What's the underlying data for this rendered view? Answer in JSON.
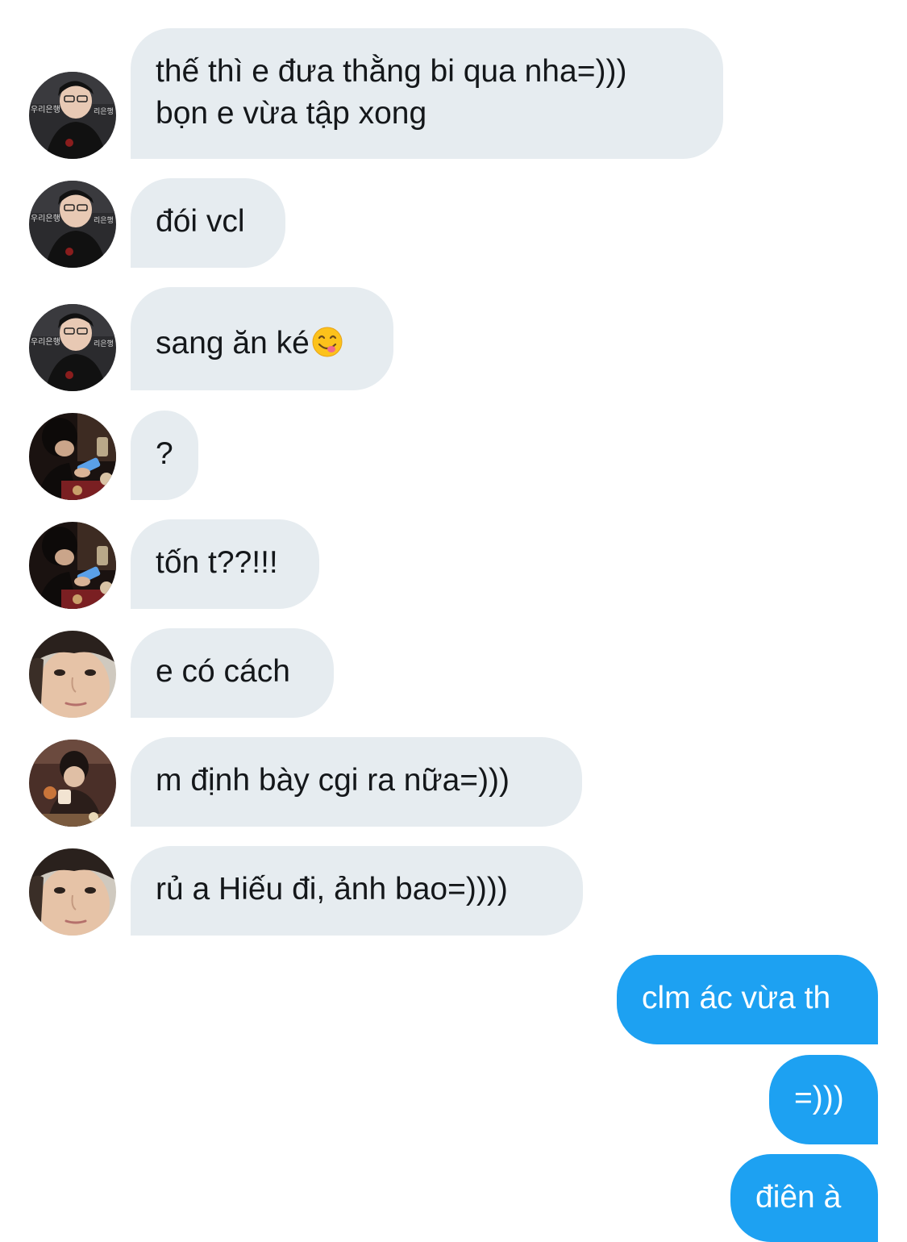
{
  "conversation": {
    "messages": [
      {
        "sender": "incoming",
        "avatar_icon": "person-avatar-1",
        "lines": [
          "thế thì e đưa thằng bi qua nha=)))",
          "bọn e vừa tập xong"
        ]
      },
      {
        "sender": "incoming",
        "avatar_icon": "person-avatar-1",
        "lines": [
          "đói vcl"
        ]
      },
      {
        "sender": "incoming",
        "avatar_icon": "person-avatar-1",
        "lines": [
          "sang ăn ké"
        ],
        "emoji": "face-savoring-food-icon"
      },
      {
        "sender": "incoming",
        "avatar_icon": "person-avatar-2",
        "lines": [
          "?"
        ]
      },
      {
        "sender": "incoming",
        "avatar_icon": "person-avatar-2",
        "lines": [
          "tốn t??!!!"
        ]
      },
      {
        "sender": "incoming",
        "avatar_icon": "person-avatar-3",
        "lines": [
          "e có cách"
        ]
      },
      {
        "sender": "incoming",
        "avatar_icon": "person-avatar-4",
        "lines": [
          "m định bày cgi ra nữa=)))"
        ]
      },
      {
        "sender": "incoming",
        "avatar_icon": "person-avatar-3",
        "lines": [
          "rủ a Hiếu đi, ảnh bao=))))"
        ]
      },
      {
        "sender": "outgoing",
        "lines": [
          "clm ác vừa th"
        ]
      },
      {
        "sender": "outgoing",
        "lines": [
          "=)))"
        ]
      },
      {
        "sender": "outgoing",
        "lines": [
          "điên à"
        ]
      }
    ]
  },
  "colors": {
    "incoming_bubble": "#e6ecf0",
    "outgoing_bubble": "#1da1f2",
    "incoming_text": "#14171a",
    "outgoing_text": "#ffffff"
  }
}
